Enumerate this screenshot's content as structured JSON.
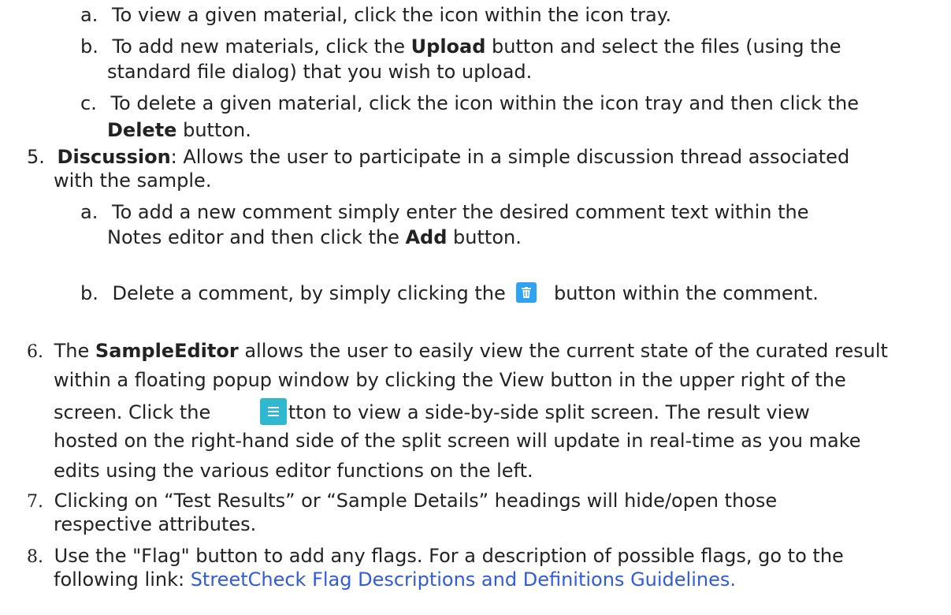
{
  "materials": {
    "a": {
      "marker": "a.",
      "text": "To view a given material, click the icon within the icon tray."
    },
    "b": {
      "marker": "b.",
      "pre": "To add new materials, click the ",
      "bold": "Upload",
      "post": " button and select the files (using the",
      "line2": "standard file dialog) that you wish to upload."
    },
    "c": {
      "marker": "c.",
      "text": "To delete a given material, click the icon within the icon tray and then click the",
      "bold": "Delete",
      "post": " button."
    }
  },
  "item5": {
    "marker": "5.",
    "bold": "Discussion",
    "post": ": Allows the user to participate in a simple discussion thread associated",
    "line2": "with the sample.",
    "a": {
      "marker": "a.",
      "line1": "To add a new comment simply enter the desired comment text within the",
      "pre2": "Notes editor and then click the ",
      "bold": "Add",
      "post2": " button."
    },
    "b": {
      "marker": "b.",
      "pre": "Delete a comment, by simply clicking the ",
      "post": " button within the comment.",
      "icon": "trash-icon"
    }
  },
  "item6": {
    "marker": "6.",
    "pre": "The ",
    "bold": "SampleEditor",
    "post": " allows the user to easily view the current state of the curated result",
    "line2": "within a floating popup window by clicking the View button in the upper right of the",
    "line3_pre": "screen. Click the ",
    "line3_post": "tton to view a side-by-side split screen. The result view",
    "line4": "hosted on the right-hand side of the split screen will update in real-time as you make",
    "line5": "edits using the various editor functions on the left.",
    "icon": "menu-icon"
  },
  "item7": {
    "marker": "7.",
    "line1": "Clicking on “Test Results” or “Sample Details” headings will hide/open those",
    "line2": "respective attributes."
  },
  "item8": {
    "marker": "8.",
    "line1": "Use the \"Flag\" button to add any flags. For a description of possible flags, go to the",
    "line2_pre": "following link: ",
    "link": "StreetCheck Flag Descriptions and Definitions Guidelines."
  },
  "colors": {
    "link": "#2f5bdc",
    "trash_button": "#2ea3f2",
    "menu_button": "#2fb8cf"
  }
}
